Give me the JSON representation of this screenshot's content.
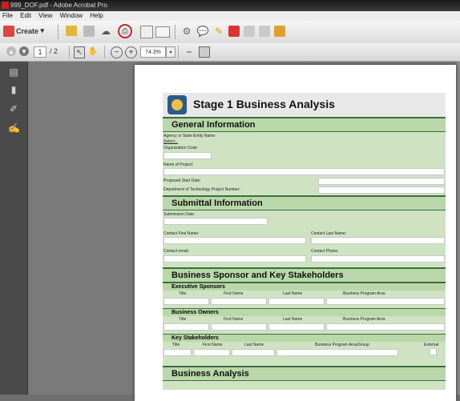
{
  "window": {
    "title": "999_DOF.pdf - Adobe Acrobat Pro"
  },
  "menu": [
    "File",
    "Edit",
    "View",
    "Window",
    "Help"
  ],
  "toolbar": {
    "create_label": "Create",
    "page_current": "1",
    "page_total": "/ 2",
    "zoom": "74.3%"
  },
  "form": {
    "title": "Stage 1 Business Analysis",
    "general": {
      "title": "General Information",
      "agency_label": "Agency or State Entity Name:",
      "agency_value": "Select...",
      "org_code_label": "Organization Code:",
      "project_name_label": "Name of Project:",
      "start_date_label": "Proposed Start Date:",
      "doit_label": "Department of Technology Project Number:"
    },
    "submittal": {
      "title": "Submittal Information",
      "submission_date_label": "Submission Date:",
      "first_name_label": "Contact First Name:",
      "last_name_label": "Contact Last Name:",
      "email_label": "Contact email:",
      "phone_label": "Contact Phone:"
    },
    "sponsor": {
      "title": "Business Sponsor and Key Stakeholders",
      "exec_title": "Executive Sponsors",
      "owners_title": "Business Owners",
      "key_title": "Key Stakeholders",
      "cols": [
        "Title",
        "First Name",
        "Last Name",
        "Business Program Area"
      ],
      "key_cols": [
        "Title",
        "First Name",
        "Last Name",
        "Business Program Area/Group",
        "External"
      ]
    },
    "analysis_title": "Business Analysis"
  }
}
